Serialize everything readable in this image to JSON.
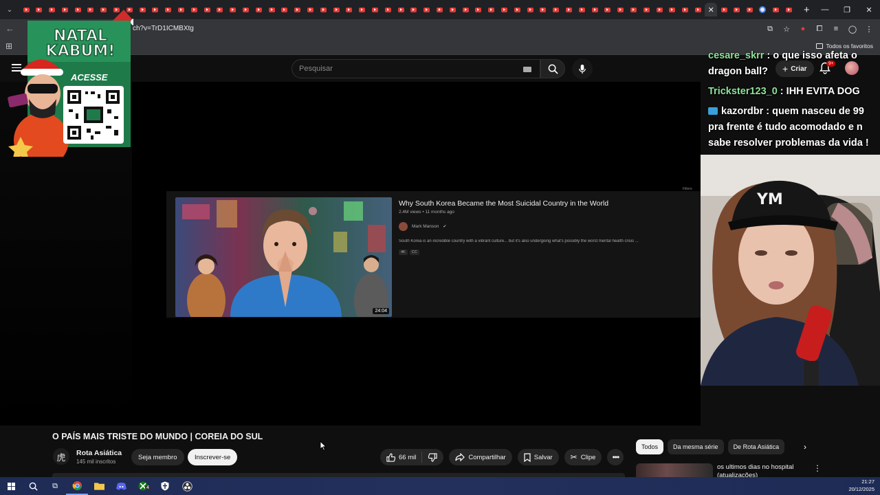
{
  "browser": {
    "url": "ch?v=TrD1ICMBXtg",
    "bookmarks_all": "Todos os favoritos",
    "tab_count": 60,
    "new_tab": "+"
  },
  "youtube": {
    "search_placeholder": "Pesquisar",
    "create_label": "Criar",
    "notifications_badge": "9+",
    "video_title": "O PAÍS MAIS TRISTE DO MUNDO | COREIA DO SUL",
    "channel": {
      "name": "Rota Asiática",
      "subscribers": "145 mil inscritos",
      "avatar_glyph": "虎"
    },
    "join_label": "Seja membro",
    "subscribe_label": "Inscrever-se",
    "likes": "66 mil",
    "share_label": "Compartilhar",
    "save_label": "Salvar",
    "clip_label": "Clipe",
    "chips": [
      "Todos",
      "Da mesma série",
      "De Rota Asiática"
    ],
    "recommendation_title": "os ultimos dias no hospital (atualizações)"
  },
  "embedded_video": {
    "title": "Why South Korea Became the Most Suicidal Country in the World",
    "meta": "2.4M views • 11 months ago",
    "channel": "Mark Manson",
    "description": "South Korea is an incredible country with a vibrant culture... but it's also undergoing what's possibly the worst mental health crisis ...",
    "badges": [
      "4K",
      "CC"
    ],
    "duration": "24:04",
    "filter_label": "Filters"
  },
  "promo": {
    "line1": "NATAL",
    "line2": "KABUM!",
    "cta": "ACESSE"
  },
  "chat": [
    {
      "user": "cesare_skrr",
      "text": " : o que isso afeta o dragon ball?",
      "icon": false
    },
    {
      "user": "Trickster123_0",
      "text": " : IHH EVITA DOG",
      "icon": false
    },
    {
      "user": "kazordbr",
      "text": " : quem nasceu de 99 pra frente é tudo acomodado e n sabe resolver problemas da vida !",
      "icon": true
    }
  ],
  "taskbar": {
    "time": "21:27",
    "date": "20/12/2025",
    "xbox_badge": "4"
  },
  "colors": {
    "yt_red": "#ff0000",
    "chat_user": "#8fe39c",
    "taskbar": "#1d2b55"
  }
}
